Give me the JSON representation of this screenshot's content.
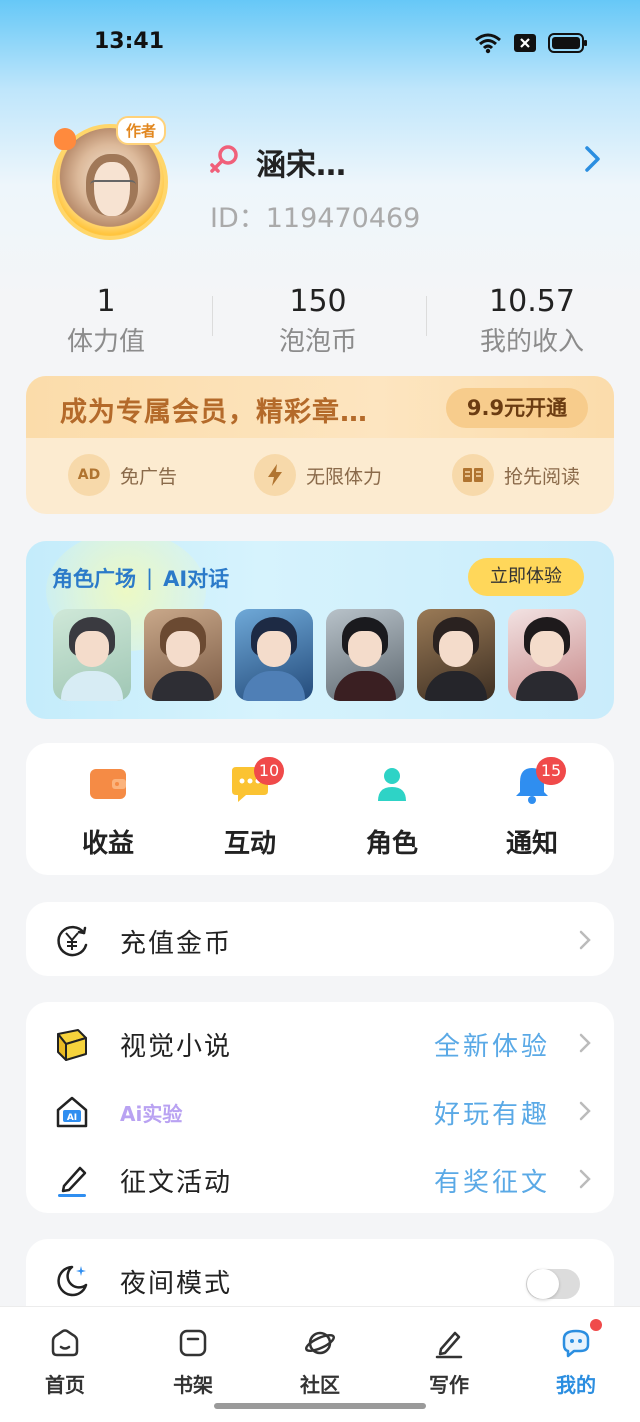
{
  "status_bar": {
    "time": "13:41"
  },
  "profile": {
    "avatar_badge": "作者",
    "name": "涵宋…",
    "id_text": "ID：119470469"
  },
  "stats": [
    {
      "value": "1",
      "label": "体力值"
    },
    {
      "value": "150",
      "label": "泡泡币"
    },
    {
      "value": "10.57",
      "label": "我的收入"
    }
  ],
  "vip": {
    "title": "成为专属会员，精彩章…",
    "button": "9.9元开通",
    "perks": [
      {
        "icon": "ad-icon",
        "icon_text": "AD",
        "label": "免广告"
      },
      {
        "icon": "lightning-icon",
        "label": "无限体力"
      },
      {
        "icon": "book-icon",
        "label": "抢先阅读"
      }
    ]
  },
  "ai_banner": {
    "title_left": "角色广场",
    "title_right": "AI对话",
    "button": "立即体验"
  },
  "shortcuts": [
    {
      "icon": "wallet-icon",
      "label": "收益",
      "badge": ""
    },
    {
      "icon": "chat-icon",
      "label": "互动",
      "badge": "10"
    },
    {
      "icon": "person-icon",
      "label": "角色",
      "badge": ""
    },
    {
      "icon": "bell-icon",
      "label": "通知",
      "badge": "15"
    }
  ],
  "recharge": {
    "label": "充值金币"
  },
  "features": [
    {
      "icon": "book-icon",
      "label": "视觉小说",
      "value": "全新体验"
    },
    {
      "icon": "ai-home-icon",
      "label": "Ai实验",
      "value": "好玩有趣"
    },
    {
      "icon": "pen-icon",
      "label": "征文活动",
      "value": "有奖征文"
    }
  ],
  "night_mode": {
    "label": "夜间模式",
    "enabled": false
  },
  "tabs": [
    {
      "icon": "home-icon",
      "label": "首页"
    },
    {
      "icon": "bookshelf-icon",
      "label": "书架"
    },
    {
      "icon": "planet-icon",
      "label": "社区"
    },
    {
      "icon": "write-icon",
      "label": "写作"
    },
    {
      "icon": "me-chat-icon",
      "label": "我的",
      "active": true
    }
  ],
  "colors": {
    "accent": "#2b8ee0",
    "badge_red": "#f04a4a",
    "vip_title": "#b46a2a",
    "link_blue": "#5aa9e6"
  }
}
